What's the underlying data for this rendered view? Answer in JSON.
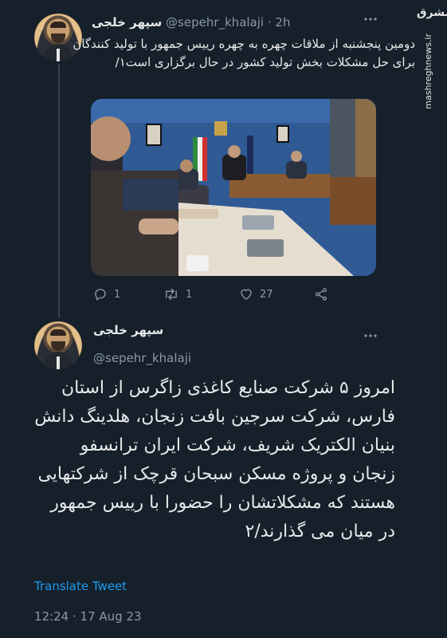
{
  "watermark": {
    "logo_text": "مشرق",
    "url": "mashreghnews.ir"
  },
  "tweet1": {
    "display_name": "سپهر خلجی",
    "handle": "@sepehr_khalaji",
    "separator": "·",
    "time": "2h",
    "more_icon": "more-dots-icon",
    "text": "دومین پنجشنبه از ملاقات چهره به چهره رییس جمهور با تولید کنندگان برای حل مشکلات بخش تولید کشور در حال برگزاری است۱/",
    "actions": {
      "reply_count": "1",
      "retweet_count": "1",
      "like_count": "27"
    }
  },
  "tweet2": {
    "display_name": "سپهر خلجی",
    "handle": "@sepehr_khalaji",
    "text": "امروز ۵ شرکت صنایع کاغذی زاگرس از استان فارس، شرکت سرجین بافت زنجان، هلدینگ دانش بنیان الکتریک شریف، شرکت ایران ترانسفو زنجان و پروژه مسکن سبحان قرچک از شرکتهایی هستند که مشکلاتشان را حضورا با رییس جمهور در میان می گذارند/۲",
    "translate_label": "Translate Tweet",
    "timestamp": "12:24 · 17 Aug 23"
  },
  "colors": {
    "background": "#15202b",
    "text_primary": "#e7e9ea",
    "text_secondary": "#8b98a5",
    "link": "#1d9bf0"
  }
}
